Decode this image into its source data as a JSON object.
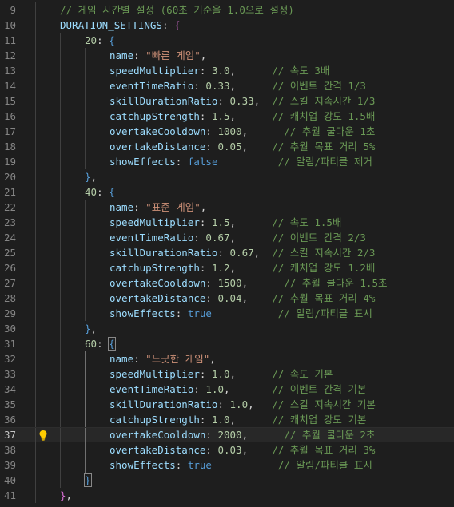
{
  "editor": {
    "current_line": 37,
    "bulb_line": 37,
    "lines": [
      {
        "n": "9",
        "indent": 2,
        "tokens": [
          {
            "t": "// 게임 시간별 설정 (60초 기준을 1.0으로 설정)",
            "c": "c"
          }
        ]
      },
      {
        "n": "10",
        "indent": 2,
        "tokens": [
          {
            "t": "DURATION_SETTINGS",
            "c": "k"
          },
          {
            "t": ": ",
            "c": "p"
          },
          {
            "t": "{",
            "c": "m"
          }
        ]
      },
      {
        "n": "11",
        "indent": 4,
        "tokens": [
          {
            "t": "20",
            "c": "n"
          },
          {
            "t": ": ",
            "c": "p"
          },
          {
            "t": "{",
            "c": "b"
          }
        ]
      },
      {
        "n": "12",
        "indent": 6,
        "tokens": [
          {
            "t": "name",
            "c": "k"
          },
          {
            "t": ": ",
            "c": "p"
          },
          {
            "t": "\"빠른 게임\"",
            "c": "s"
          },
          {
            "t": ",",
            "c": "p"
          }
        ]
      },
      {
        "n": "13",
        "indent": 6,
        "tokens": [
          {
            "t": "speedMultiplier",
            "c": "k"
          },
          {
            "t": ": ",
            "c": "p"
          },
          {
            "t": "3.0",
            "c": "n"
          },
          {
            "t": ",      ",
            "c": "p"
          },
          {
            "t": "// 속도 3배",
            "c": "c"
          }
        ]
      },
      {
        "n": "14",
        "indent": 6,
        "tokens": [
          {
            "t": "eventTimeRatio",
            "c": "k"
          },
          {
            "t": ": ",
            "c": "p"
          },
          {
            "t": "0.33",
            "c": "n"
          },
          {
            "t": ",      ",
            "c": "p"
          },
          {
            "t": "// 이벤트 간격 1/3",
            "c": "c"
          }
        ]
      },
      {
        "n": "15",
        "indent": 6,
        "tokens": [
          {
            "t": "skillDurationRatio",
            "c": "k"
          },
          {
            "t": ": ",
            "c": "p"
          },
          {
            "t": "0.33",
            "c": "n"
          },
          {
            "t": ",  ",
            "c": "p"
          },
          {
            "t": "// 스킬 지속시간 1/3",
            "c": "c"
          }
        ]
      },
      {
        "n": "16",
        "indent": 6,
        "tokens": [
          {
            "t": "catchupStrength",
            "c": "k"
          },
          {
            "t": ": ",
            "c": "p"
          },
          {
            "t": "1.5",
            "c": "n"
          },
          {
            "t": ",      ",
            "c": "p"
          },
          {
            "t": "// 캐치업 강도 1.5배",
            "c": "c"
          }
        ]
      },
      {
        "n": "17",
        "indent": 6,
        "tokens": [
          {
            "t": "overtakeCooldown",
            "c": "k"
          },
          {
            "t": ": ",
            "c": "p"
          },
          {
            "t": "1000",
            "c": "n"
          },
          {
            "t": ",      ",
            "c": "p"
          },
          {
            "t": "// 추월 쿨다운 1초",
            "c": "c"
          }
        ]
      },
      {
        "n": "18",
        "indent": 6,
        "tokens": [
          {
            "t": "overtakeDistance",
            "c": "k"
          },
          {
            "t": ": ",
            "c": "p"
          },
          {
            "t": "0.05",
            "c": "n"
          },
          {
            "t": ",    ",
            "c": "p"
          },
          {
            "t": "// 추월 목표 거리 5%",
            "c": "c"
          }
        ]
      },
      {
        "n": "19",
        "indent": 6,
        "tokens": [
          {
            "t": "showEffects",
            "c": "k"
          },
          {
            "t": ": ",
            "c": "p"
          },
          {
            "t": "false",
            "c": "b"
          },
          {
            "t": "          ",
            "c": "p"
          },
          {
            "t": "// 알림/파티클 제거",
            "c": "c"
          }
        ]
      },
      {
        "n": "20",
        "indent": 4,
        "tokens": [
          {
            "t": "}",
            "c": "b"
          },
          {
            "t": ",",
            "c": "p"
          }
        ]
      },
      {
        "n": "21",
        "indent": 4,
        "tokens": [
          {
            "t": "40",
            "c": "n"
          },
          {
            "t": ": ",
            "c": "p"
          },
          {
            "t": "{",
            "c": "b"
          }
        ]
      },
      {
        "n": "22",
        "indent": 6,
        "tokens": [
          {
            "t": "name",
            "c": "k"
          },
          {
            "t": ": ",
            "c": "p"
          },
          {
            "t": "\"표준 게임\"",
            "c": "s"
          },
          {
            "t": ",",
            "c": "p"
          }
        ]
      },
      {
        "n": "23",
        "indent": 6,
        "tokens": [
          {
            "t": "speedMultiplier",
            "c": "k"
          },
          {
            "t": ": ",
            "c": "p"
          },
          {
            "t": "1.5",
            "c": "n"
          },
          {
            "t": ",      ",
            "c": "p"
          },
          {
            "t": "// 속도 1.5배",
            "c": "c"
          }
        ]
      },
      {
        "n": "24",
        "indent": 6,
        "tokens": [
          {
            "t": "eventTimeRatio",
            "c": "k"
          },
          {
            "t": ": ",
            "c": "p"
          },
          {
            "t": "0.67",
            "c": "n"
          },
          {
            "t": ",      ",
            "c": "p"
          },
          {
            "t": "// 이벤트 간격 2/3",
            "c": "c"
          }
        ]
      },
      {
        "n": "25",
        "indent": 6,
        "tokens": [
          {
            "t": "skillDurationRatio",
            "c": "k"
          },
          {
            "t": ": ",
            "c": "p"
          },
          {
            "t": "0.67",
            "c": "n"
          },
          {
            "t": ",  ",
            "c": "p"
          },
          {
            "t": "// 스킬 지속시간 2/3",
            "c": "c"
          }
        ]
      },
      {
        "n": "26",
        "indent": 6,
        "tokens": [
          {
            "t": "catchupStrength",
            "c": "k"
          },
          {
            "t": ": ",
            "c": "p"
          },
          {
            "t": "1.2",
            "c": "n"
          },
          {
            "t": ",      ",
            "c": "p"
          },
          {
            "t": "// 캐치업 강도 1.2배",
            "c": "c"
          }
        ]
      },
      {
        "n": "27",
        "indent": 6,
        "tokens": [
          {
            "t": "overtakeCooldown",
            "c": "k"
          },
          {
            "t": ": ",
            "c": "p"
          },
          {
            "t": "1500",
            "c": "n"
          },
          {
            "t": ",      ",
            "c": "p"
          },
          {
            "t": "// 추월 쿨다운 1.5초",
            "c": "c"
          }
        ]
      },
      {
        "n": "28",
        "indent": 6,
        "tokens": [
          {
            "t": "overtakeDistance",
            "c": "k"
          },
          {
            "t": ": ",
            "c": "p"
          },
          {
            "t": "0.04",
            "c": "n"
          },
          {
            "t": ",    ",
            "c": "p"
          },
          {
            "t": "// 추월 목표 거리 4%",
            "c": "c"
          }
        ]
      },
      {
        "n": "29",
        "indent": 6,
        "tokens": [
          {
            "t": "showEffects",
            "c": "k"
          },
          {
            "t": ": ",
            "c": "p"
          },
          {
            "t": "true",
            "c": "b"
          },
          {
            "t": "           ",
            "c": "p"
          },
          {
            "t": "// 알림/파티클 표시",
            "c": "c"
          }
        ]
      },
      {
        "n": "30",
        "indent": 4,
        "tokens": [
          {
            "t": "}",
            "c": "b"
          },
          {
            "t": ",",
            "c": "p"
          }
        ]
      },
      {
        "n": "31",
        "indent": 4,
        "tokens": [
          {
            "t": "60",
            "c": "n"
          },
          {
            "t": ": ",
            "c": "p"
          },
          {
            "t": "{",
            "c": "b",
            "match": true
          }
        ]
      },
      {
        "n": "32",
        "indent": 6,
        "tokens": [
          {
            "t": "name",
            "c": "k"
          },
          {
            "t": ": ",
            "c": "p"
          },
          {
            "t": "\"느긋한 게임\"",
            "c": "s"
          },
          {
            "t": ",",
            "c": "p"
          }
        ]
      },
      {
        "n": "33",
        "indent": 6,
        "tokens": [
          {
            "t": "speedMultiplier",
            "c": "k"
          },
          {
            "t": ": ",
            "c": "p"
          },
          {
            "t": "1.0",
            "c": "n"
          },
          {
            "t": ",      ",
            "c": "p"
          },
          {
            "t": "// 속도 기본",
            "c": "c"
          }
        ]
      },
      {
        "n": "34",
        "indent": 6,
        "tokens": [
          {
            "t": "eventTimeRatio",
            "c": "k"
          },
          {
            "t": ": ",
            "c": "p"
          },
          {
            "t": "1.0",
            "c": "n"
          },
          {
            "t": ",       ",
            "c": "p"
          },
          {
            "t": "// 이벤트 간격 기본",
            "c": "c"
          }
        ]
      },
      {
        "n": "35",
        "indent": 6,
        "tokens": [
          {
            "t": "skillDurationRatio",
            "c": "k"
          },
          {
            "t": ": ",
            "c": "p"
          },
          {
            "t": "1.0",
            "c": "n"
          },
          {
            "t": ",   ",
            "c": "p"
          },
          {
            "t": "// 스킬 지속시간 기본",
            "c": "c"
          }
        ]
      },
      {
        "n": "36",
        "indent": 6,
        "tokens": [
          {
            "t": "catchupStrength",
            "c": "k"
          },
          {
            "t": ": ",
            "c": "p"
          },
          {
            "t": "1.0",
            "c": "n"
          },
          {
            "t": ",      ",
            "c": "p"
          },
          {
            "t": "// 캐치업 강도 기본",
            "c": "c"
          }
        ]
      },
      {
        "n": "37",
        "indent": 6,
        "tokens": [
          {
            "t": "overtakeCooldown",
            "c": "k"
          },
          {
            "t": ": ",
            "c": "p"
          },
          {
            "t": "2000",
            "c": "n"
          },
          {
            "t": ",      ",
            "c": "p"
          },
          {
            "t": "// 추월 쿨다운 2초",
            "c": "c"
          }
        ]
      },
      {
        "n": "38",
        "indent": 6,
        "tokens": [
          {
            "t": "overtakeDistance",
            "c": "k"
          },
          {
            "t": ": ",
            "c": "p"
          },
          {
            "t": "0.03",
            "c": "n"
          },
          {
            "t": ",    ",
            "c": "p"
          },
          {
            "t": "// 추월 목표 거리 3%",
            "c": "c"
          }
        ]
      },
      {
        "n": "39",
        "indent": 6,
        "tokens": [
          {
            "t": "showEffects",
            "c": "k"
          },
          {
            "t": ": ",
            "c": "p"
          },
          {
            "t": "true",
            "c": "b"
          },
          {
            "t": "           ",
            "c": "p"
          },
          {
            "t": "// 알림/파티클 표시",
            "c": "c"
          }
        ]
      },
      {
        "n": "40",
        "indent": 4,
        "tokens": [
          {
            "t": "}",
            "c": "b",
            "match": true
          }
        ]
      },
      {
        "n": "41",
        "indent": 2,
        "tokens": [
          {
            "t": "}",
            "c": "m"
          },
          {
            "t": ",",
            "c": "p"
          }
        ]
      }
    ]
  },
  "icons": {
    "bulb": "lightbulb-icon"
  },
  "colors": {
    "background": "#1e1e1e",
    "comment": "#6a9955",
    "property": "#9cdcfe",
    "number": "#b5cea8",
    "string": "#ce9178",
    "keyword": "#569cd6",
    "bracket_outer": "#da70d6",
    "lightbulb": "#ffcc00"
  }
}
